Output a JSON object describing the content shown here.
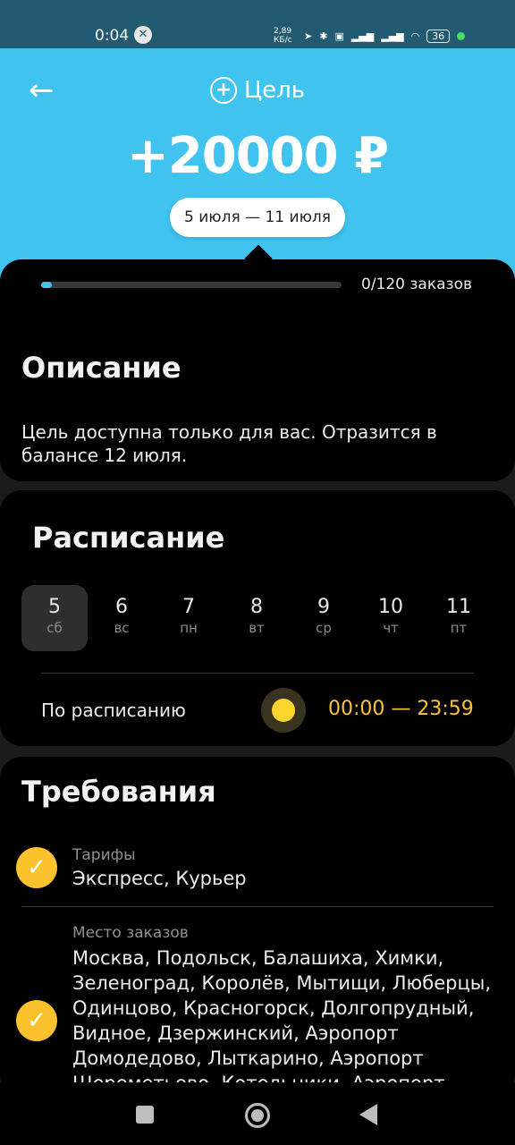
{
  "status_bar": {
    "time": "0:04",
    "speed": "2,89 КБ/с",
    "battery": "36",
    "icons": [
      "notification-icon",
      "location-icon",
      "bluetooth-icon",
      "vibrate-icon",
      "signal-icon",
      "signal-icon",
      "wifi-icon",
      "battery-icon"
    ]
  },
  "header": {
    "back_icon": "arrow-left-icon",
    "title_icon": "plus-circle-icon",
    "title": "Цель",
    "amount": "+20000 ₽",
    "date_range": "5 июля — 11 июля",
    "background": "#41c3f0"
  },
  "progress": {
    "value": 0,
    "total": 120,
    "label": "0/120 заказов",
    "accent": "#41c3f0"
  },
  "description": {
    "heading": "Описание",
    "text": "Цель доступна только для вас. Отразится в балансе 12 июля."
  },
  "schedule": {
    "heading": "Расписание",
    "days": [
      {
        "num": "5",
        "wd": "сб",
        "selected": true
      },
      {
        "num": "6",
        "wd": "вс",
        "selected": false
      },
      {
        "num": "7",
        "wd": "пн",
        "selected": false
      },
      {
        "num": "8",
        "wd": "вт",
        "selected": false
      },
      {
        "num": "9",
        "wd": "ср",
        "selected": false
      },
      {
        "num": "10",
        "wd": "чт",
        "selected": false
      },
      {
        "num": "11",
        "wd": "пт",
        "selected": false
      }
    ],
    "mode_label": "По расписанию",
    "mode_icon": "sun-icon",
    "time_range": "00:00 — 23:59",
    "accent": "#fcc437"
  },
  "requirements": {
    "heading": "Требования",
    "items": [
      {
        "title": "Тарифы",
        "value": "Экспресс, Курьер"
      },
      {
        "title": "Место заказов",
        "lines": [
          "Москва, Подольск, Балашиха, Химки,",
          "Зеленоград, Королёв, Мытищи, Люберцы,",
          "Одинцово, Красногорск, Долгопрудный,",
          "Видное, Дзержинский, Аэропорт",
          "Домодедово, Лыткарино, Аэропорт",
          "Шереметьево, Котельники, Аэропорт"
        ]
      }
    ],
    "check_icon": "check-icon",
    "check_color": "#fcc22e"
  },
  "nav": {
    "recent": "square-icon",
    "home": "circle-icon",
    "back": "triangle-back-icon"
  }
}
